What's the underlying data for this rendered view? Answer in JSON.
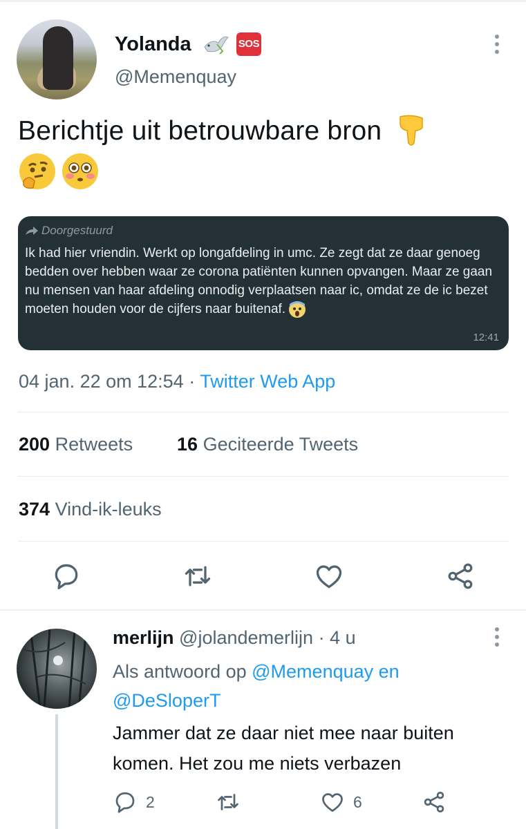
{
  "tweet": {
    "author_name": "Yolanda",
    "author_handle": "@Memenquay",
    "badge_sos": "SOS",
    "text": "Berichtje uit betrouwbare bron",
    "emojis": [
      "backhand-index-pointing-down",
      "thinking-face",
      "flushed-face"
    ],
    "forwarded": {
      "label": "Doorgestuurd",
      "text": "Ik had hier vriendin. Werkt op longafdeling in umc. Ze zegt dat ze daar genoeg bedden over hebben waar ze corona patiënten kunnen opvangen. Maar ze gaan nu mensen van haar afdeling onnodig verplaatsen naar ic, omdat ze de ic bezet moeten houden voor de cijfers naar buitenaf.",
      "time": "12:41"
    },
    "date": "04 jan. 22 om 12:54",
    "dot": "·",
    "source": "Twitter Web App",
    "retweets_count": "200",
    "retweets_label": "Retweets",
    "quotes_count": "16",
    "quotes_label": "Geciteerde Tweets",
    "likes_count": "374",
    "likes_label": "Vind-ik-leuks"
  },
  "reply": {
    "author_name": "merlijn",
    "author_handle": "@jolandemerlijn",
    "time": "· 4 u",
    "replying_prefix": "Als antwoord op",
    "replying_user1": "@Memenquay",
    "replying_and": "en",
    "replying_user2": "@DeSloperT",
    "text": "Jammer dat ze daar niet mee naar buiten komen. Het zou me niets verbazen",
    "reply_count": "2",
    "like_count": "6"
  },
  "icons": [
    "dove-icon",
    "sos-icon",
    "more-icon",
    "reply-icon",
    "retweet-icon",
    "like-icon",
    "share-icon",
    "forward-arrow-icon",
    "screaming-face-icon"
  ],
  "colors": {
    "link": "#1d9bf0",
    "secondary_text": "#536471",
    "forward_bg": "#233137"
  }
}
